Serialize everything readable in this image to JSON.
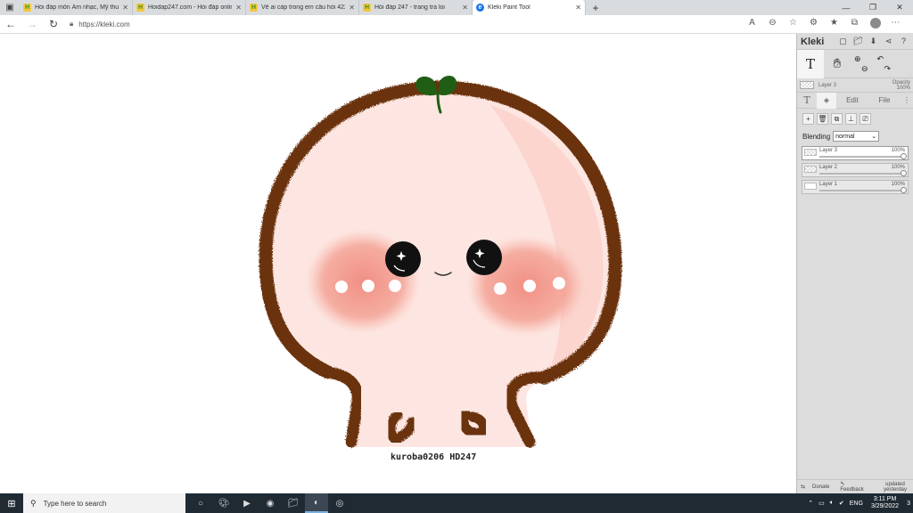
{
  "browser": {
    "tabs": [
      {
        "title": "Hỏi đáp môn Âm nhạc, Mỹ thuật",
        "icon": "hoidap-favicon",
        "active": false
      },
      {
        "title": "Hoidap247.com - Hỏi đáp online",
        "icon": "hoidap-favicon",
        "active": false
      },
      {
        "title": "Vẽ ai cáp trong em câu hỏi 4228",
        "icon": "hoidap-favicon",
        "active": false
      },
      {
        "title": "Hỏi đáp 247 - trang tra loi",
        "icon": "hoidap-favicon",
        "active": false
      },
      {
        "title": "Kleki Paint Tool",
        "icon": "edge-favicon",
        "active": true
      }
    ],
    "url": "https://kleki.com"
  },
  "canvas": {
    "credit": "kuroba0206 HD247",
    "colors": {
      "outline": "#6b3210",
      "skin": "#fde6e1",
      "blush": "#f08a7e",
      "leaf": "#1f5e14",
      "eye": "#111111"
    }
  },
  "panel": {
    "brand": "Kleki",
    "current_layer": {
      "name": "Layer 3",
      "opacity_label": "Opacity",
      "opacity_value": "100%"
    },
    "tabs": {
      "text": "T",
      "edit": "Edit",
      "file": "File"
    },
    "blending_label": "Blending",
    "blending_value": "normal",
    "layers": [
      {
        "name": "Layer 3",
        "opacity": "100%",
        "active": true
      },
      {
        "name": "Layer 2",
        "opacity": "100%",
        "active": false
      },
      {
        "name": "Layer 1",
        "opacity": "100%",
        "active": false
      }
    ],
    "footer": {
      "donate": "Donate",
      "feedback": "Feedback",
      "updated_line1": "updated",
      "updated_line2": "yesterday"
    }
  },
  "taskbar": {
    "search_placeholder": "Type here to search",
    "language": "ENG",
    "time": "3:11 PM",
    "date": "3/29/2022",
    "notifications": "3"
  }
}
